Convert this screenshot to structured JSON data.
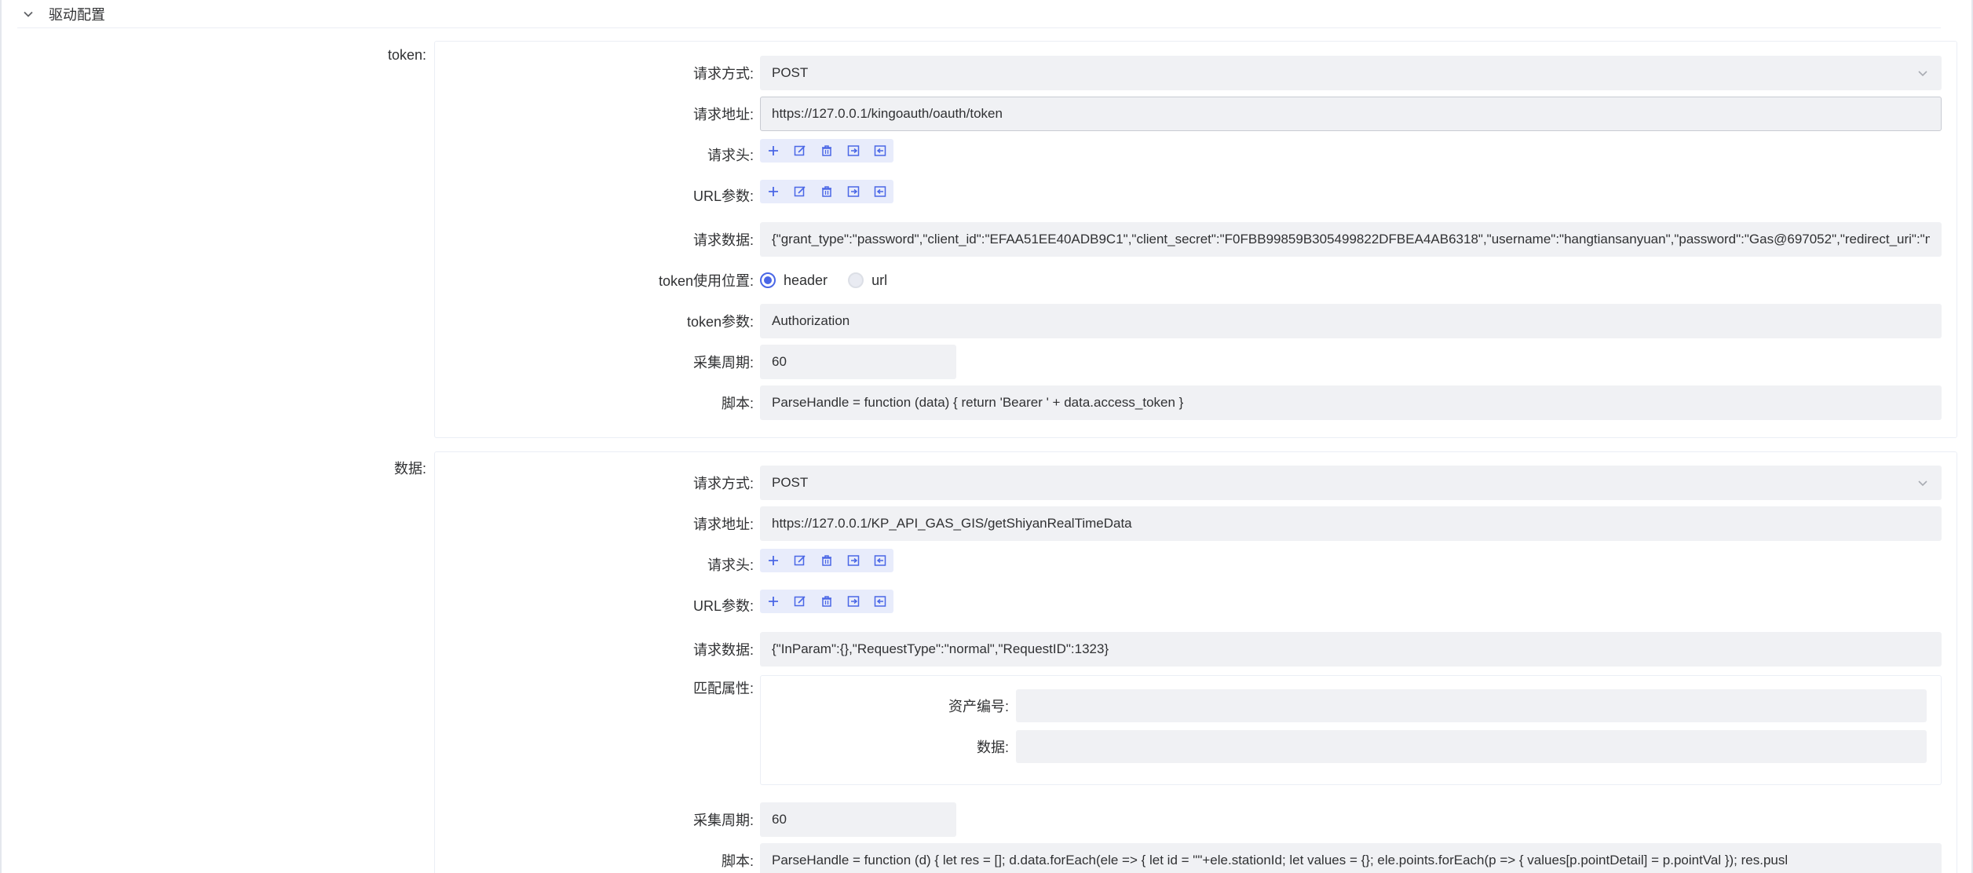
{
  "section": {
    "title": "驱动配置"
  },
  "token_group": {
    "label": "token:",
    "method_label": "请求方式:",
    "method_value": "POST",
    "url_label": "请求地址:",
    "url_value": "https://127.0.0.1/kingoauth/oauth/token",
    "headers_label": "请求头:",
    "params_label": "URL参数:",
    "body_label": "请求数据:",
    "body_value": "{\"grant_type\":\"password\",\"client_id\":\"EFAA51EE40ADB9C1\",\"client_secret\":\"F0FBB99859B305499822DFBEA4AB6318\",\"username\":\"hangtiansanyuan\",\"password\":\"Gas@697052\",\"redirect_uri\":\"m",
    "position_label": "token使用位置:",
    "position_options": [
      "header",
      "url"
    ],
    "position_selected": "header",
    "param_label": "token参数:",
    "param_value": "Authorization",
    "period_label": "采集周期:",
    "period_value": "60",
    "script_label": "脚本:",
    "script_value": "ParseHandle = function (data) {   return 'Bearer ' + data.access_token }"
  },
  "data_group": {
    "label": "数据:",
    "method_label": "请求方式:",
    "method_value": "POST",
    "url_label": "请求地址:",
    "url_value": "https://127.0.0.1/KP_API_GAS_GIS/getShiyanRealTimeData",
    "headers_label": "请求头:",
    "params_label": "URL参数:",
    "body_label": "请求数据:",
    "body_value": "{\"InParam\":{},\"RequestType\":\"normal\",\"RequestID\":1323}",
    "match_label": "匹配属性:",
    "match_asset_label": "资产编号:",
    "match_data_label": "数据:",
    "period_label": "采集周期:",
    "period_value": "60",
    "script_label": "脚本:",
    "script_value": "ParseHandle = function (d) {   let res = [];   d.data.forEach(ele => {     let id = \"\"+ele.stationId;     let values = {};     ele.points.forEach(p => {       values[p.pointDetail] = p.pointVal     });     res.pusl"
  },
  "toolbar_icons": [
    "plus-icon",
    "edit-icon",
    "delete-icon",
    "import-icon",
    "export-icon"
  ],
  "colors": {
    "accent": "#4a67e6",
    "field_bg": "#f0f1f4",
    "toolbar_bg": "#e8ecfb"
  }
}
